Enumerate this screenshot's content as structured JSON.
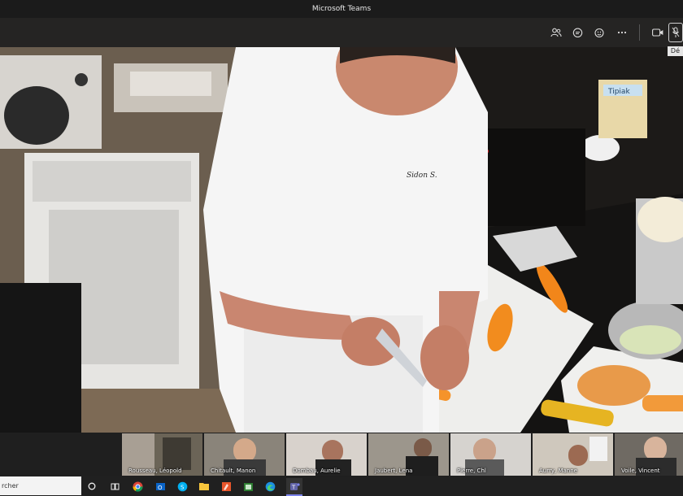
{
  "window": {
    "title": "Microsoft Teams"
  },
  "toolbar": {
    "tooltip": "Dé",
    "icons": [
      "participants-icon",
      "chat-icon",
      "reactions-icon",
      "more-icon",
      "camera-icon",
      "mic-icon"
    ]
  },
  "video": {
    "jacket_label": "Sidon S.",
    "package_label": "Tipiak"
  },
  "participants": [
    {
      "name": "Rousseau, Léopold"
    },
    {
      "name": "Chitault, Manon"
    },
    {
      "name": "Dombau, Aurelie"
    },
    {
      "name": "Jaubert, Lena"
    },
    {
      "name": "Pierre, Chl"
    },
    {
      "name": "Aurry, Manne"
    },
    {
      "name": "Voile, Vincent"
    }
  ],
  "taskbar": {
    "search_text": "rcher"
  },
  "colors": {
    "teams_purple": "#6264a7",
    "toolbar_bg": "#252423",
    "carrot": "#f28c1e"
  }
}
